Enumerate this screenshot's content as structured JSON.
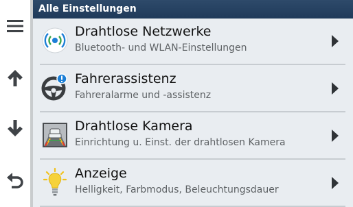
{
  "header": {
    "title": "Alle Einstellungen"
  },
  "sidebar": {
    "menu_icon": "hamburger-menu-icon",
    "up_icon": "arrow-up-icon",
    "down_icon": "arrow-down-icon",
    "back_icon": "back-arrow-icon"
  },
  "items": [
    {
      "title": "Drahtlose Netzwerke",
      "subtitle": "Bluetooth- und WLAN-Einstellungen",
      "icon": "wireless-icon"
    },
    {
      "title": "Fahrerassistenz",
      "subtitle": "Fahreralarme und -assistenz",
      "icon": "steering-wheel-alert-icon"
    },
    {
      "title": "Drahtlose Kamera",
      "subtitle": "Einrichtung u. Einst. der drahtlosen Kamera",
      "icon": "backup-camera-icon"
    },
    {
      "title": "Anzeige",
      "subtitle": "Helligkeit, Farbmodus, Beleuchtungsdauer",
      "icon": "lightbulb-icon"
    }
  ],
  "colors": {
    "header_bg": "#1f3a5a",
    "content_bg": "#e9edf1",
    "accent_blue": "#1c7fd6",
    "wireless_green": "#3aa64a"
  }
}
